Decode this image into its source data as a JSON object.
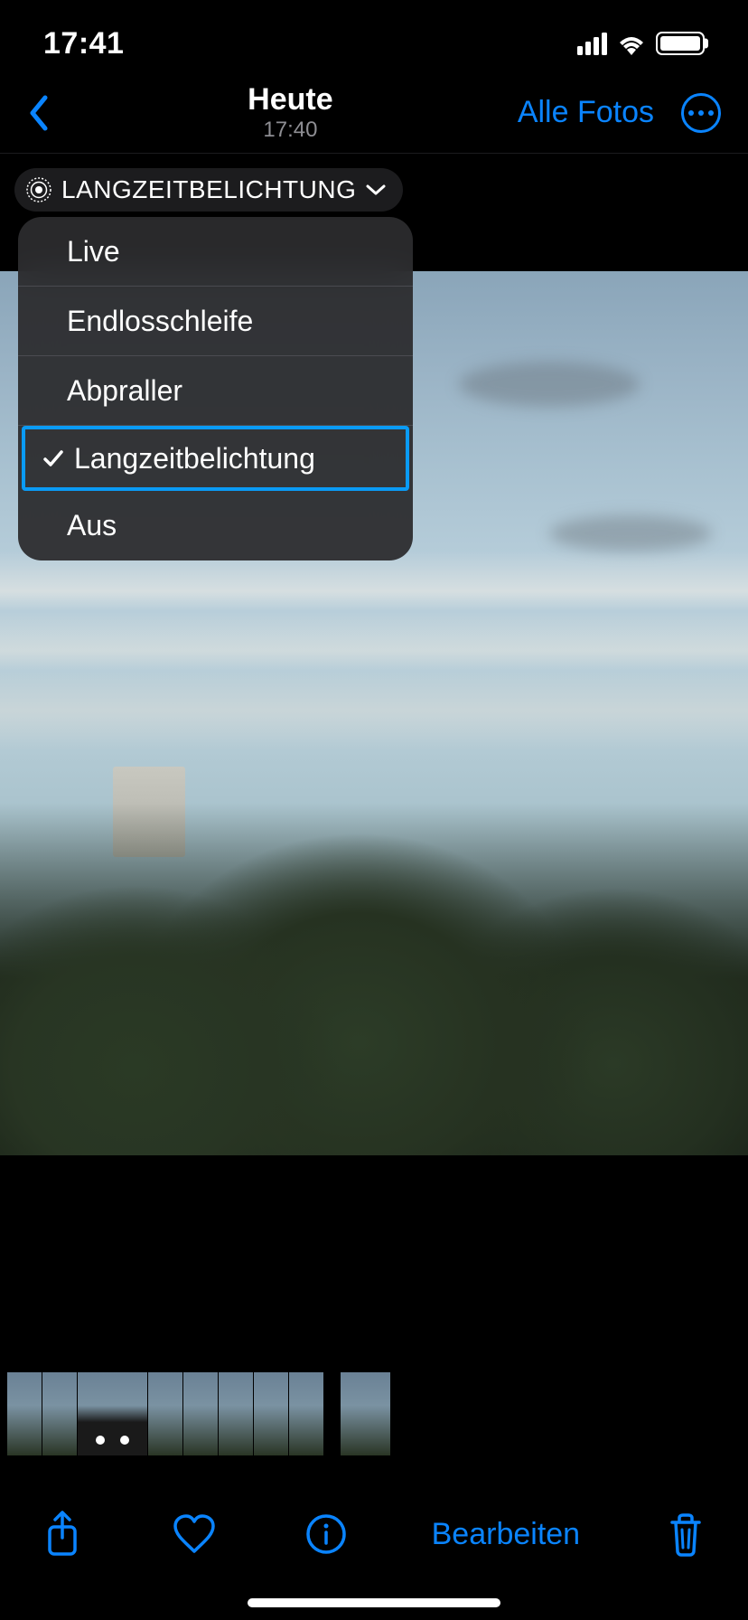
{
  "statusBar": {
    "time": "17:41"
  },
  "nav": {
    "title": "Heute",
    "subtitle": "17:40",
    "allPhotos": "Alle Fotos"
  },
  "badge": {
    "label": "LANGZEITBELICHTUNG"
  },
  "dropdown": {
    "items": [
      {
        "label": "Live",
        "selected": false
      },
      {
        "label": "Endlosschleife",
        "selected": false
      },
      {
        "label": "Abpraller",
        "selected": false
      },
      {
        "label": "Langzeitbelichtung",
        "selected": true
      },
      {
        "label": "Aus",
        "selected": false
      }
    ]
  },
  "toolbar": {
    "editLabel": "Bearbeiten"
  },
  "colors": {
    "accent": "#0a84ff"
  }
}
